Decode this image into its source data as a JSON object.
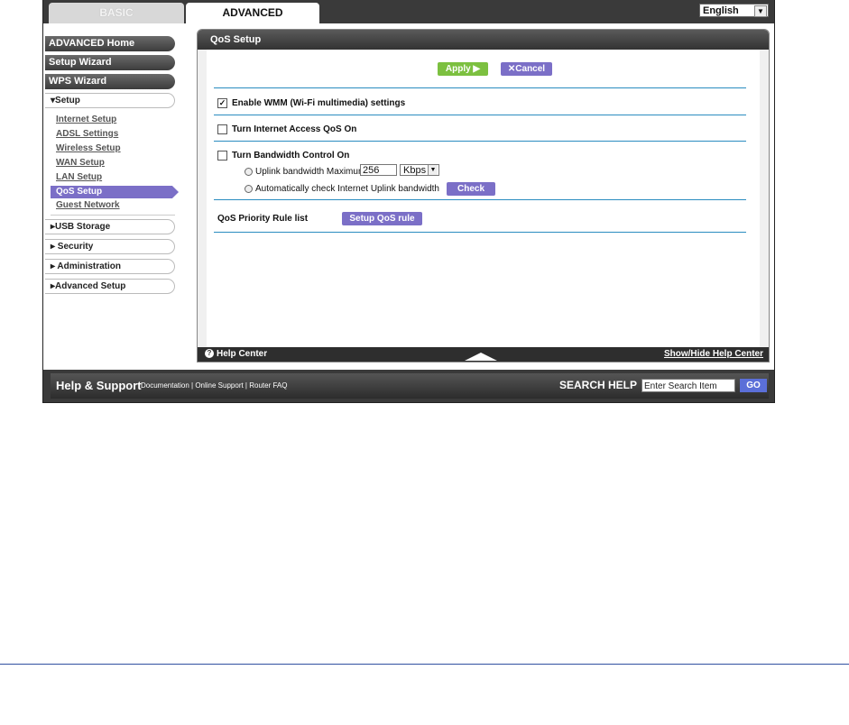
{
  "tabs": {
    "basic": "BASIC",
    "advanced": "ADVANCED"
  },
  "language": "English",
  "nav": {
    "advanced_home": "ADVANCED Home",
    "setup_wizard": "Setup Wizard",
    "wps_wizard": "WPS Wizard",
    "setup": "▾Setup",
    "setup_items": [
      "Internet Setup",
      "ADSL Settings",
      "Wireless Setup",
      "WAN Setup",
      "LAN Setup",
      "QoS Setup",
      "Guest Network"
    ],
    "usb_storage": "▸USB Storage",
    "security": "▸ Security",
    "administration": "▸ Administration",
    "advanced_setup": "▸Advanced Setup"
  },
  "panel": {
    "title": "QoS Setup",
    "apply": "Apply ▶",
    "cancel": "✕Cancel",
    "enable_wmm": "Enable WMM (Wi-Fi multimedia) settings",
    "enable_wmm_checked": true,
    "internet_qos": "Turn Internet Access QoS On",
    "bandwidth_control": "Turn Bandwidth Control On",
    "uplink_label": "Uplink bandwidth Maximum",
    "uplink_value": "256",
    "uplink_unit": "Kbps",
    "auto_check": "Automatically check Internet Uplink bandwidth",
    "check": "Check",
    "priority_list": "QoS Priority Rule list",
    "setup_rule": "Setup QoS rule"
  },
  "helpbar": {
    "label": "Help Center",
    "toggle": "Show/Hide Help Center"
  },
  "footer": {
    "title": "Help & Support",
    "links": "Documentation | Online Support | Router FAQ",
    "search_label": "SEARCH HELP",
    "search_value": "Enter Search Item",
    "go": "GO"
  }
}
